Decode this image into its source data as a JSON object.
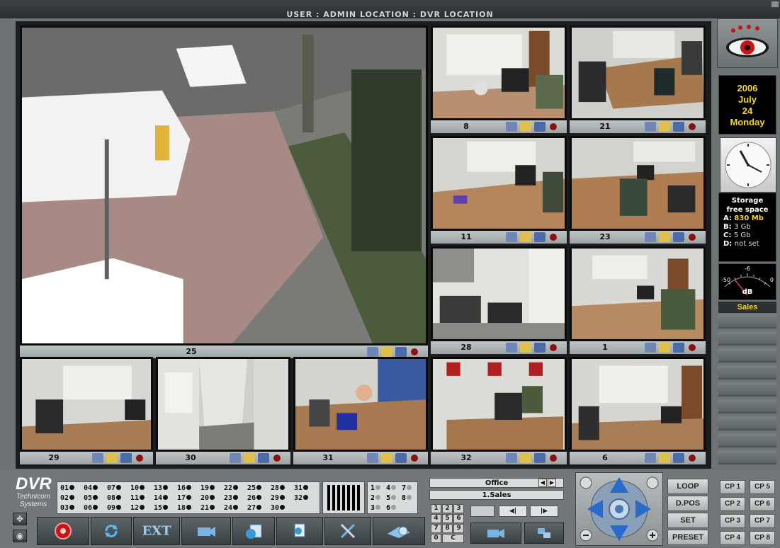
{
  "header": {
    "title": "USER : ADMIN   LOCATION : DVR LOCATION"
  },
  "cameras": {
    "main": "25",
    "tiles": [
      "8",
      "21",
      "11",
      "23",
      "28",
      "1",
      "29",
      "30",
      "31",
      "32",
      "6"
    ]
  },
  "info_panel": {
    "year": "2006",
    "month": "July",
    "day": "24",
    "weekday": "Monday",
    "storage_title_1": "Storage",
    "storage_title_2": "free space",
    "drives": [
      {
        "label": "A:",
        "value": "830 Mb"
      },
      {
        "label": "B:",
        "value": "3 Gb"
      },
      {
        "label": "C:",
        "value": "5 Gb"
      },
      {
        "label": "D:",
        "value": "not set"
      }
    ],
    "meter_unit": "dB",
    "meter_min": "-50",
    "meter_mid": "-6",
    "meter_max": "0",
    "active_group": "Sales"
  },
  "logo": {
    "name": "DVR",
    "line1": "Technicom",
    "line2": "Systems"
  },
  "camera_list": [
    [
      "01",
      "04",
      "07",
      "10",
      "13",
      "16",
      "19",
      "22",
      "25",
      "28",
      "31"
    ],
    [
      "02",
      "05",
      "08",
      "11",
      "14",
      "17",
      "20",
      "23",
      "26",
      "29",
      "32"
    ],
    [
      "03",
      "06",
      "09",
      "12",
      "15",
      "18",
      "21",
      "24",
      "27",
      "30"
    ]
  ],
  "audio_channels": [
    [
      "1",
      "4",
      "7"
    ],
    [
      "2",
      "5",
      "8"
    ],
    [
      "3",
      "6"
    ]
  ],
  "toolbar": {
    "ext_label": "EXT"
  },
  "controls": {
    "location_value": "Office",
    "group_value": "1.Sales",
    "keypad": [
      "1",
      "2",
      "3",
      "4",
      "5",
      "6",
      "7",
      "8",
      "9",
      "0",
      "C"
    ]
  },
  "ptz_buttons": {
    "loop": "LOOP",
    "dpos": "D.POS",
    "set": "SET",
    "preset": "PRESET"
  },
  "cp_buttons": [
    "CP 1",
    "CP 5",
    "CP 2",
    "CP 6",
    "CP 3",
    "CP 7",
    "CP 4",
    "CP 8"
  ],
  "colors": {
    "accent": "#f4d62b",
    "record": "#c81414",
    "frame": "#1b1d1e"
  }
}
